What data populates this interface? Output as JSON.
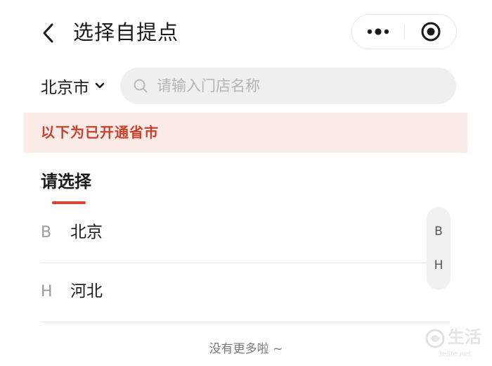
{
  "header": {
    "title": "选择自提点",
    "back_icon": "chevron-left-icon",
    "more_icon": "more-dots-icon",
    "close_icon": "target-close-icon"
  },
  "search_row": {
    "city": "北京市",
    "city_icon": "chevron-down-icon",
    "search_placeholder": "请输入门店名称",
    "search_icon": "search-icon"
  },
  "notice": {
    "text": "以下为已开通省市"
  },
  "tab": {
    "label": "请选择"
  },
  "list": {
    "items": [
      {
        "letter": "B",
        "name": "北京"
      },
      {
        "letter": "H",
        "name": "河北"
      }
    ]
  },
  "index_bar": {
    "letters": [
      "B",
      "H"
    ]
  },
  "footer": {
    "text": "没有更多啦 ~"
  },
  "watermark": {
    "text": "生活",
    "url": "3elife.net"
  },
  "colors": {
    "accent": "#d9432f",
    "notice_bg": "#fbebe6",
    "notice_text": "#c9412d",
    "search_bg": "#efefef"
  }
}
